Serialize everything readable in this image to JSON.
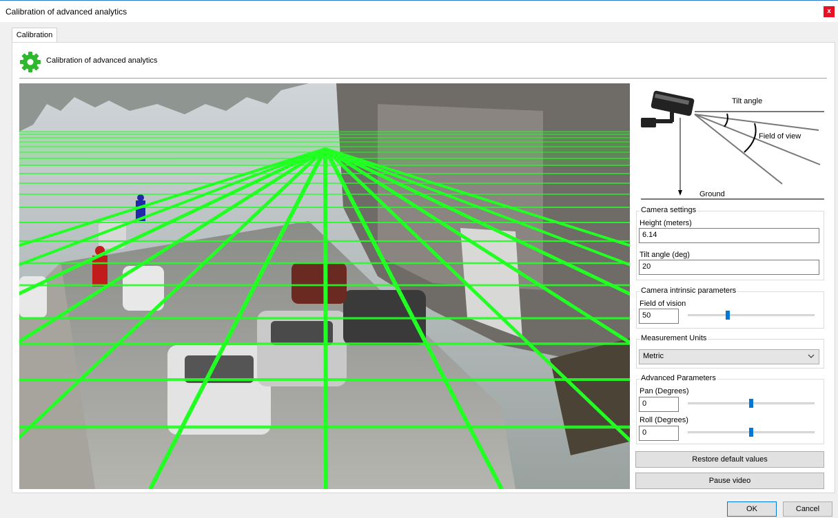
{
  "window": {
    "title": "Calibration of advanced analytics",
    "close_glyph": "x"
  },
  "tabs": [
    {
      "label": "Calibration",
      "active": true
    }
  ],
  "header": {
    "icon": "gear-icon",
    "text": "Calibration of advanced analytics",
    "icon_color": "#2db82d"
  },
  "video": {
    "overlay_color": "#22ff22"
  },
  "diagram": {
    "tilt_label": "Tilt angle",
    "fov_label": "Field of view",
    "ground_label": "Ground"
  },
  "camera_settings": {
    "title": "Camera settings",
    "height_label": "Height (meters)",
    "height_value": "6.14",
    "tilt_label": "Tilt angle (deg)",
    "tilt_value": "20"
  },
  "intrinsic": {
    "title": "Camera intrinsic parameters",
    "fov_label": "Field of vision",
    "fov_value": "50"
  },
  "units": {
    "title": "Measurement Units",
    "selected": "Metric"
  },
  "advanced": {
    "title": "Advanced Parameters",
    "pan_label": "Pan (Degrees)",
    "pan_value": "0",
    "roll_label": "Roll (Degrees)",
    "roll_value": "0"
  },
  "buttons": {
    "restore": "Restore default values",
    "pause": "Pause video",
    "ok": "OK",
    "cancel": "Cancel"
  }
}
